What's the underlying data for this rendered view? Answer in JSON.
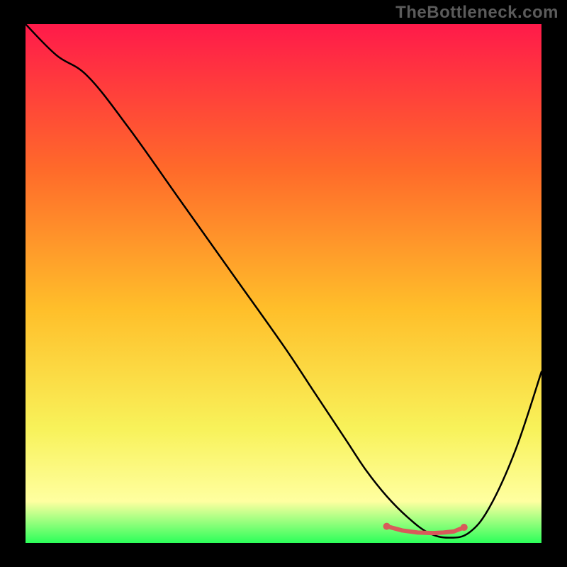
{
  "watermark": "TheBottleneck.com",
  "colors": {
    "background": "#000000",
    "gradient_top": "#ff1a4a",
    "gradient_upper_mid": "#ff6a2a",
    "gradient_mid": "#ffbf2a",
    "gradient_lower_mid": "#f8f25a",
    "gradient_lower": "#ffffa0",
    "gradient_bottom": "#2cff5a",
    "curve_stroke": "#000000",
    "marker_stroke": "#d85a5a",
    "watermark_color": "#5b5b5b"
  },
  "chart_data": {
    "type": "line",
    "title": "",
    "xlabel": "",
    "ylabel": "",
    "xlim": [
      0,
      100
    ],
    "ylim": [
      0,
      100
    ],
    "x": [
      0,
      6,
      12,
      20,
      30,
      40,
      50,
      56,
      62,
      66,
      70,
      74,
      78,
      82,
      86,
      90,
      95,
      100
    ],
    "y": [
      100,
      94,
      90,
      80,
      66,
      52,
      38,
      29,
      20,
      14,
      9,
      5,
      2,
      1,
      2,
      7,
      18,
      33
    ],
    "markers": {
      "x": [
        70,
        73,
        76,
        79,
        81,
        83,
        85
      ],
      "y": [
        3.2,
        2.4,
        2.0,
        1.9,
        2.0,
        2.2,
        3.0
      ]
    },
    "notes": "V-shaped bottleneck curve over vertical rainbow gradient; minimum (~1%) near x≈80; markers highlight the trough region."
  }
}
